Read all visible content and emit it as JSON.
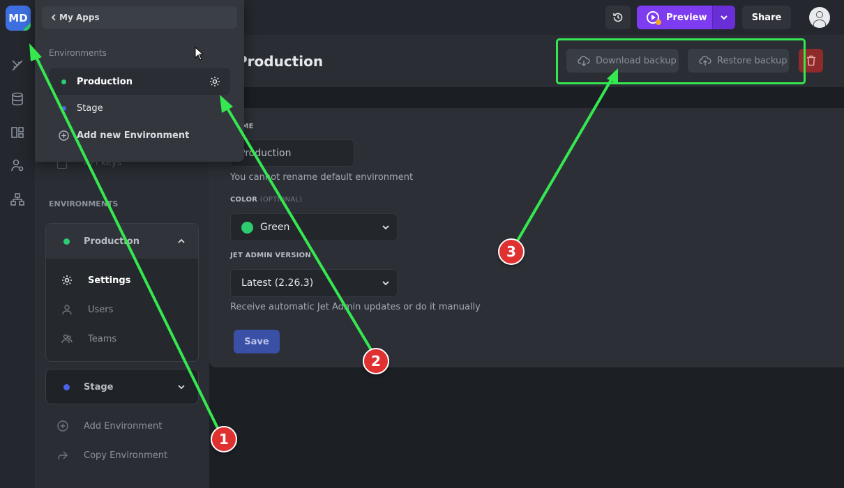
{
  "app": {
    "logo_text": "MD",
    "brand_color": "#3d6fe0"
  },
  "rail": {
    "icons": [
      "ruler-pencil-icon",
      "database-icon",
      "layout-grid-icon",
      "users-settings-icon",
      "sitemap-icon"
    ]
  },
  "topbar": {
    "preview_label": "Preview",
    "share_label": "Share"
  },
  "page": {
    "title": "Production",
    "download_label": "Download backup",
    "restore_label": "Restore backup"
  },
  "nav": {
    "faded_item": "API keys",
    "environments_section": "ENVIRONMENTS",
    "production": {
      "label": "Production",
      "color": "#2ecc71",
      "items": [
        {
          "label": "Settings",
          "icon": "gear-icon",
          "active": true
        },
        {
          "label": "Users",
          "icon": "user-icon"
        },
        {
          "label": "Teams",
          "icon": "team-icon"
        }
      ]
    },
    "stage": {
      "label": "Stage",
      "color": "#4a63e8"
    },
    "add_env_label": "Add Environment",
    "copy_env_label": "Copy Environment"
  },
  "form": {
    "name_label": "NAME",
    "name_value": "Production",
    "name_help": "You cannot rename default environment",
    "color_label": "COLOR",
    "color_optional": "(OPTIONAL)",
    "color_value": "Green",
    "version_label": "JET ADMIN VERSION",
    "version_value": "Latest (2.26.3)",
    "version_help": "Receive automatic Jet Admin updates or do it manually",
    "save_label": "Save"
  },
  "popover": {
    "back_label": "My Apps",
    "section_label": "Environments",
    "items": [
      {
        "label": "Production",
        "color": "#2ecc71",
        "active": true
      },
      {
        "label": "Stage",
        "color": "#4a63e8"
      }
    ],
    "add_label": "Add new Environment"
  },
  "annotations": {
    "badges": [
      "1",
      "2",
      "3"
    ],
    "color": "#35e84f"
  }
}
